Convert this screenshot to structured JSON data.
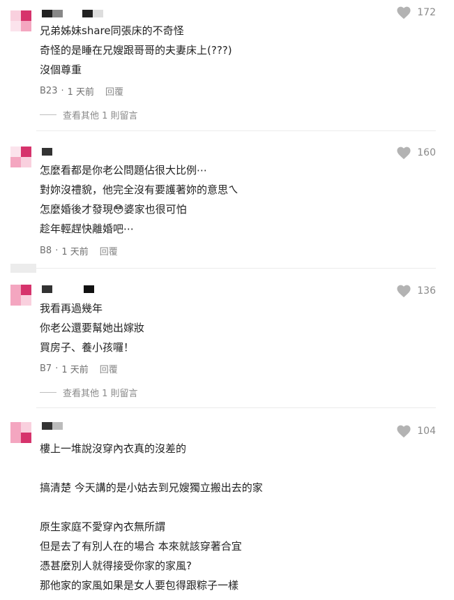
{
  "colors": {
    "accent": "#d6336c",
    "avatar_light": "#f4a6c0",
    "name_dark": "#222222",
    "name_grey": "#9a9a9a",
    "heart": "#b3b3b3"
  },
  "comments": [
    {
      "likes": "172",
      "lines": [
        "兄弟姊妹share同張床的不奇怪",
        "奇怪的是睡在兄嫂跟哥哥的夫妻床上(???)",
        "沒個尊重"
      ],
      "floor": "B23",
      "time": "1 天前",
      "reply": "回覆",
      "more": "查看其他 1 則留言"
    },
    {
      "likes": "160",
      "lines": [
        "怎麼看都是你老公問題佔很大比例⋯",
        "對妳沒禮貌，他完全沒有要護著妳的意思ㄟ",
        "怎麼婚後才發現😳婆家也很可怕",
        "趁年輕趕快離婚吧⋯"
      ],
      "floor": "B8",
      "time": "1 天前",
      "reply": "回覆"
    },
    {
      "likes": "136",
      "lines": [
        "我看再過幾年",
        "你老公還要幫她出嫁妝",
        "買房子、養小孩囉！"
      ],
      "floor": "B7",
      "time": "1 天前",
      "reply": "回覆",
      "more": "查看其他 1 則留言"
    },
    {
      "likes": "104",
      "lines": [
        "樓上一堆說沒穿內衣真的沒差的",
        "",
        "搞清楚 今天講的是小姑去到兄嫂獨立搬出去的家",
        "",
        "原生家庭不愛穿內衣無所謂",
        "但是去了有別人在的場合 本來就該穿著合宜",
        "憑甚麼別人就得接受你家的家風?",
        "那他家的家風如果是女人要包得跟粽子一樣"
      ]
    }
  ],
  "meta_separator": "·"
}
